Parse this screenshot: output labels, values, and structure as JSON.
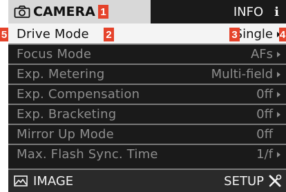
{
  "header": {
    "camera_tab": "CAMERA",
    "info_tab": "INFO",
    "info_icon_char": "i"
  },
  "menu": {
    "items": [
      {
        "label": "Drive Mode",
        "value": "Single",
        "arrow": true,
        "selected": true
      },
      {
        "label": "Focus Mode",
        "value": "AFs",
        "arrow": true
      },
      {
        "label": "Exp. Metering",
        "value": "Multi-field",
        "arrow": true
      },
      {
        "label": "Exp. Compensation",
        "value": "0ff",
        "arrow": true
      },
      {
        "label": "Exp. Bracketing",
        "value": "0ff",
        "arrow": true
      },
      {
        "label": "Mirror Up Mode",
        "value": "0ff",
        "arrow": false
      },
      {
        "label": "Max. Flash Sync. Time",
        "value": "1/f",
        "arrow": true
      }
    ]
  },
  "footer": {
    "image_tab": "IMAGE",
    "setup_tab": "SETUP"
  },
  "callouts": [
    "1",
    "2",
    "3",
    "4",
    "5"
  ],
  "colors": {
    "callout": "#e5432b",
    "selected_row_bg": "#f4f4f4",
    "screen_bg": "#1a1a1a",
    "inactive_text": "#8e8e8e"
  },
  "icons": {
    "camera_tab": "camera-icon",
    "image_tab": "image-icon",
    "setup_tab": "wrench-screwdriver-icon"
  }
}
